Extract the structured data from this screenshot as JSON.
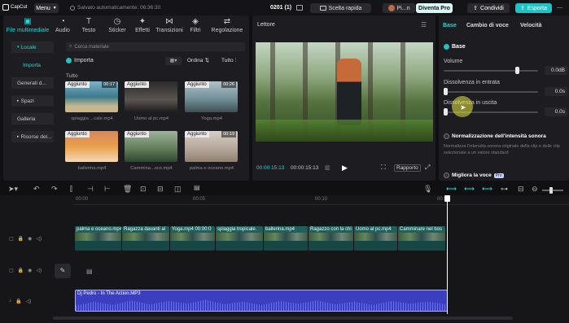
{
  "topbar": {
    "logo": "CapCut",
    "menu": "Menu",
    "saved_status": "Salvato automaticamente: 06:36:30",
    "project": "0201 (1)",
    "shortcuts": "Scelta rapida",
    "user": "Pi...n",
    "pro": "Diventa Pro",
    "share": "Condividi",
    "export": "Esporta"
  },
  "media": {
    "tabs": [
      "File multimediale",
      "Audio",
      "Testo",
      "Sticker",
      "Effetti",
      "Transizioni",
      "Filtri",
      "Regolazione"
    ],
    "sidebar": [
      "Locale",
      "Importa",
      "Generati d...",
      "Spazi",
      "Galleria",
      "Risorse del..."
    ],
    "search_placeholder": "Cerca materiale",
    "import_label": "Importa",
    "sort_label": "Ordina",
    "filter_label": "Tutto",
    "section_label": "Tutto",
    "added_badge": "Aggiunto",
    "items": [
      {
        "name": "spiaggia ...cale.mp4",
        "duration": "00:17"
      },
      {
        "name": "Uomo al pc.mp4",
        "duration": ""
      },
      {
        "name": "Yoga.mp4",
        "duration": "00:26"
      },
      {
        "name": "ballerina.mp4",
        "duration": ""
      },
      {
        "name": "Cammina...sco.mp4",
        "duration": ""
      },
      {
        "name": "palma e oceano.mp4",
        "duration": "00:19"
      }
    ]
  },
  "player": {
    "title": "Lettore",
    "current_time": "00:00:15:13",
    "total_time": "00:00:15:13",
    "ratio": "Rapporto"
  },
  "inspector": {
    "tabs": [
      "Base",
      "Cambio di voce",
      "Velocità"
    ],
    "section": "Base",
    "volume_label": "Volume",
    "volume_value": "0.0dB",
    "volume_level": 0.8,
    "fade_in_label": "Dissolvenza in entrata",
    "fade_in_value": "0.0s",
    "fade_out_label": "Dissolvenza in uscita",
    "fade_out_value": "0.0s",
    "normalize_title": "Normalizzazione dell'intensità sonora",
    "normalize_desc": "Normalizza l'intensità sonora originale della clip o delle clip selezionate a un valore standard",
    "enhance_label": "Migliora la voce",
    "enhance_badge": "Pro"
  },
  "timeline": {
    "ruler": [
      "00:00",
      "00:05",
      "00:10",
      "00:15"
    ],
    "clips": [
      "palma e oceano.mp4",
      "Ragazza davanti al",
      "Yoga.mp4  00:00:0",
      "spiaggia tropicale.",
      "ballerina.mp4",
      "Ragazzo con la chi",
      "Uomo al pc.mp4",
      "Camminare nel bos"
    ],
    "audio": "Dj Pedro - In The Action.MP3"
  }
}
